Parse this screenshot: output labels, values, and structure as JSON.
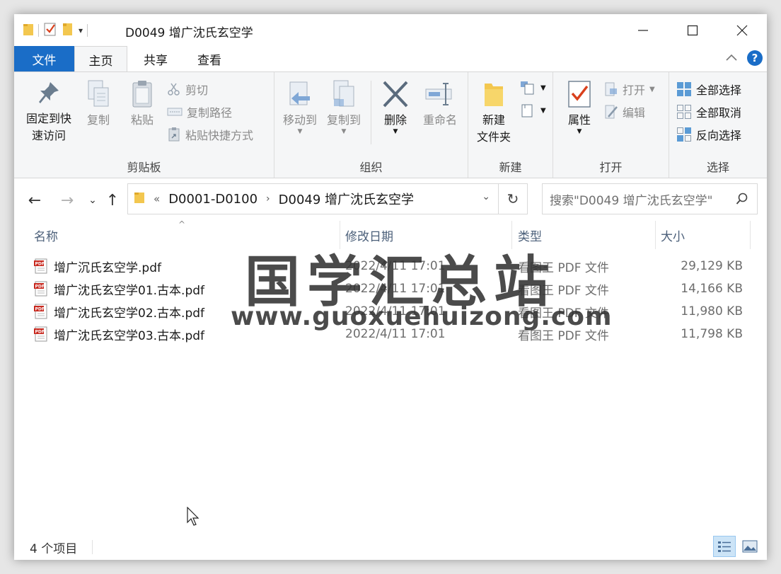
{
  "window": {
    "title": "D0049 增广沈氏玄空学"
  },
  "tabs": {
    "file": "文件",
    "home": "主页",
    "share": "共享",
    "view": "查看"
  },
  "ribbon": {
    "clipboard": {
      "label": "剪贴板",
      "pin": "固定到快速访问",
      "pin_line1": "固定到快",
      "pin_line2": "速访问",
      "copy": "复制",
      "paste": "粘贴",
      "cut": "剪切",
      "copy_path": "复制路径",
      "paste_shortcut": "粘贴快捷方式"
    },
    "organize": {
      "label": "组织",
      "move_to": "移动到",
      "copy_to": "复制到",
      "delete": "删除",
      "rename": "重命名"
    },
    "new": {
      "label": "新建",
      "new_folder_line1": "新建",
      "new_folder_line2": "文件夹"
    },
    "open": {
      "label": "打开",
      "properties": "属性",
      "open": "打开",
      "edit": "编辑"
    },
    "select": {
      "label": "选择",
      "select_all": "全部选择",
      "select_none": "全部取消",
      "invert": "反向选择"
    }
  },
  "address": {
    "overflow": "«",
    "crumbs": [
      "D0001-D0100",
      "D0049 增广沈氏玄空学"
    ],
    "search_placeholder": "搜索\"D0049 增广沈氏玄空学\""
  },
  "columns": {
    "name": "名称",
    "date": "修改日期",
    "type": "类型",
    "size": "大小"
  },
  "files": [
    {
      "name": "增广沉氏玄空学.pdf",
      "date": "2022/4/11 17:01",
      "type": "看图王 PDF 文件",
      "size": "29,129 KB"
    },
    {
      "name": "增广沈氏玄空学01.古本.pdf",
      "date": "2022/4/11 17:01",
      "type": "看图王 PDF 文件",
      "size": "14,166 KB"
    },
    {
      "name": "增广沈氏玄空学02.古本.pdf",
      "date": "2022/4/11 17:01",
      "type": "看图王 PDF 文件",
      "size": "11,980 KB"
    },
    {
      "name": "增广沈氏玄空学03.古本.pdf",
      "date": "2022/4/11 17:01",
      "type": "看图王 PDF 文件",
      "size": "11,798 KB"
    }
  ],
  "status": {
    "count": "4 个项目"
  },
  "watermark": {
    "line1": "国学汇总站",
    "line2": "www.guoxuehuizong.com"
  },
  "colors": {
    "file_tab": "#1a6dc7",
    "folder": "#f3c74f",
    "pdf_red": "#c8281e",
    "help": "#1a6dc7"
  }
}
